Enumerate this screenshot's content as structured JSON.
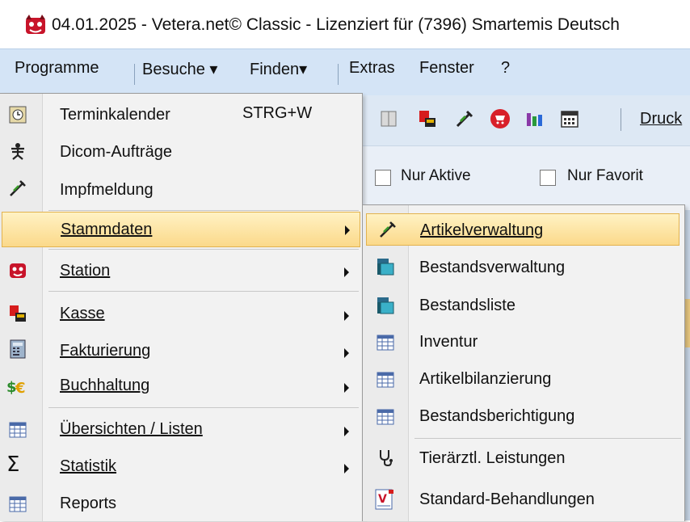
{
  "window": {
    "title": "04.01.2025 - Vetera.net© Classic - Lizenziert für (7396) Smartemis Deutsch",
    "logo_icon": "vetera-dog-icon"
  },
  "menubar": {
    "items": [
      {
        "label": "Programme"
      },
      {
        "label": "Besuche ▾"
      },
      {
        "label": "Finden▾"
      },
      {
        "label": "Extras"
      },
      {
        "label": "Fenster"
      },
      {
        "label": "?"
      }
    ]
  },
  "toolbar": {
    "icons": [
      "book-icon",
      "cash-register-icon",
      "syringe-icon",
      "cart-icon",
      "lab-icon",
      "calendar-icon"
    ],
    "druck_label": "Druck"
  },
  "filters": {
    "nur_aktive": {
      "label": "Nur Aktive",
      "checked": false
    },
    "nur_favorit": {
      "label": "Nur Favorit",
      "checked": false
    }
  },
  "programme_menu": {
    "items": [
      {
        "label": "Terminkalender",
        "shortcut": "STRG+W",
        "icon": "clock-icon"
      },
      {
        "label": "Dicom-Aufträge",
        "icon": "xray-icon"
      },
      {
        "label": "Impfmeldung",
        "icon": "syringe-icon"
      },
      {
        "label": "Stammdaten",
        "submenu": true,
        "highlighted": true
      },
      {
        "label": "Station",
        "submenu": true,
        "icon": "vetera-dog-icon"
      },
      {
        "label": "Kasse",
        "submenu": true,
        "icon": "cash-register-icon"
      },
      {
        "label": "Fakturierung",
        "submenu": true,
        "icon": "invoice-icon"
      },
      {
        "label": "Buchhaltung",
        "submenu": true,
        "icon": "currency-icon"
      },
      {
        "label": "Übersichten / Listen",
        "submenu": true,
        "icon": "table-icon"
      },
      {
        "label": "Statistik",
        "submenu": true,
        "icon": "sigma-icon"
      },
      {
        "label": "Reports",
        "icon": "table-icon"
      }
    ]
  },
  "stammdaten_submenu": {
    "items": [
      {
        "label": "Artikelverwaltung",
        "icon": "syringe-icon",
        "highlighted": true
      },
      {
        "label": "Bestandsverwaltung",
        "icon": "stock-icon"
      },
      {
        "label": "Bestandsliste",
        "icon": "stock-icon"
      },
      {
        "label": "Inventur",
        "icon": "table-icon"
      },
      {
        "label": "Artikelbilanzierung",
        "icon": "table-icon"
      },
      {
        "label": "Bestandsberichtigung",
        "icon": "table-icon"
      },
      {
        "label": "Tierärztl. Leistungen",
        "icon": "stethoscope-icon"
      },
      {
        "label": "Standard-Behandlungen",
        "icon": "treatment-icon"
      }
    ]
  },
  "colors": {
    "highlight_top": "#fff2c4",
    "highlight_bottom": "#fbd98a",
    "menubar_bg": "#d4e4f6"
  }
}
